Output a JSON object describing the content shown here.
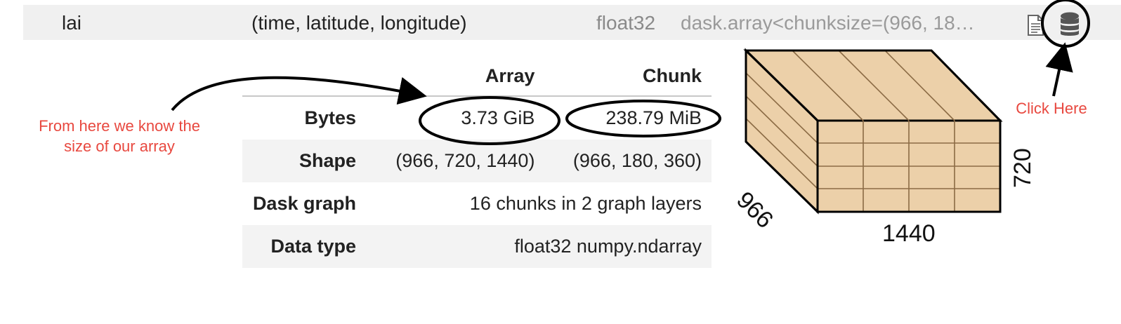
{
  "variable": {
    "name": "lai",
    "dims": "(time, latitude, longitude)",
    "dtype": "float32",
    "preview": "dask.array<chunksize=(966, 18…",
    "icons": {
      "attributes": "file-text-icon",
      "data": "database-icon"
    }
  },
  "table": {
    "headers": [
      "",
      "Array",
      "Chunk"
    ],
    "rows": [
      {
        "label": "Bytes",
        "array": "3.73 GiB",
        "chunk": "238.79 MiB"
      },
      {
        "label": "Shape",
        "array": "(966, 720, 1440)",
        "chunk": "(966, 180, 360)"
      },
      {
        "label": "Dask graph",
        "merged": "16 chunks in 2 graph layers"
      },
      {
        "label": "Data type",
        "merged": "float32 numpy.ndarray"
      }
    ]
  },
  "cube": {
    "depth_label": "966",
    "height_label": "720",
    "width_label": "1440",
    "fill_color": "#ecd0a9",
    "grid_color": "#8b6b45"
  },
  "annotations": {
    "left": "From here we know the size of our array",
    "right": "Click Here",
    "color": "#e8483f"
  }
}
